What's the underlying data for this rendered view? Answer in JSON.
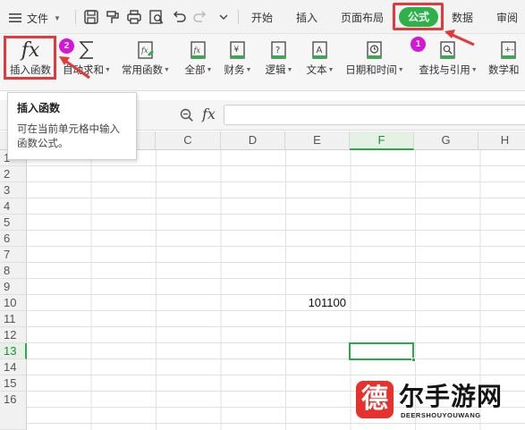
{
  "menubar": {
    "file_label": "文件",
    "tabs": [
      {
        "label": "开始"
      },
      {
        "label": "插入"
      },
      {
        "label": "页面布局"
      },
      {
        "label": "公式"
      },
      {
        "label": "数据"
      },
      {
        "label": "审阅"
      }
    ],
    "quick_access_icons": [
      "save-icon",
      "format-painter-icon",
      "print-icon",
      "print-preview-icon",
      "undo-icon",
      "redo-icon",
      "more-icon"
    ],
    "active_tab_color": "#2db24a"
  },
  "ribbon": {
    "buttons": [
      {
        "label": "插入函数",
        "icon": "fx-icon"
      },
      {
        "label": "自动求和",
        "icon": "sigma-icon"
      },
      {
        "label": "常用函数",
        "icon": "common-functions-icon"
      },
      {
        "label": "全部",
        "icon": "all-functions-icon"
      },
      {
        "label": "财务",
        "icon": "finance-icon"
      },
      {
        "label": "逻辑",
        "icon": "logic-icon"
      },
      {
        "label": "文本",
        "icon": "text-function-icon"
      },
      {
        "label": "日期和时间",
        "icon": "date-time-icon"
      },
      {
        "label": "查找与引用",
        "icon": "lookup-icon"
      },
      {
        "label": "数学和",
        "icon": "math-icon"
      }
    ]
  },
  "tooltip": {
    "title": "插入函数",
    "body": "可在当前单元格中输入函数公式。"
  },
  "annotations": {
    "badge1": "1",
    "badge2": "2",
    "highlight_color": "#e23a3a",
    "badge_color": "#d516d6"
  },
  "formula_bar": {
    "fx_label": "fx",
    "value": ""
  },
  "grid": {
    "columns": [
      "C",
      "D",
      "E",
      "F",
      "G",
      "H"
    ],
    "selected_column": "F",
    "rows": [
      "1",
      "2",
      "3",
      "4",
      "5",
      "6",
      "7",
      "8",
      "9",
      "10",
      "11",
      "12",
      "13",
      "14",
      "15",
      "16"
    ],
    "selected_row": "13",
    "cell_value_E10": "101100",
    "selection_color": "#2aa84a"
  },
  "watermark": {
    "logo_char": "德",
    "text": "尔手游网",
    "sub": "DEERSHOUYOUWANG"
  }
}
